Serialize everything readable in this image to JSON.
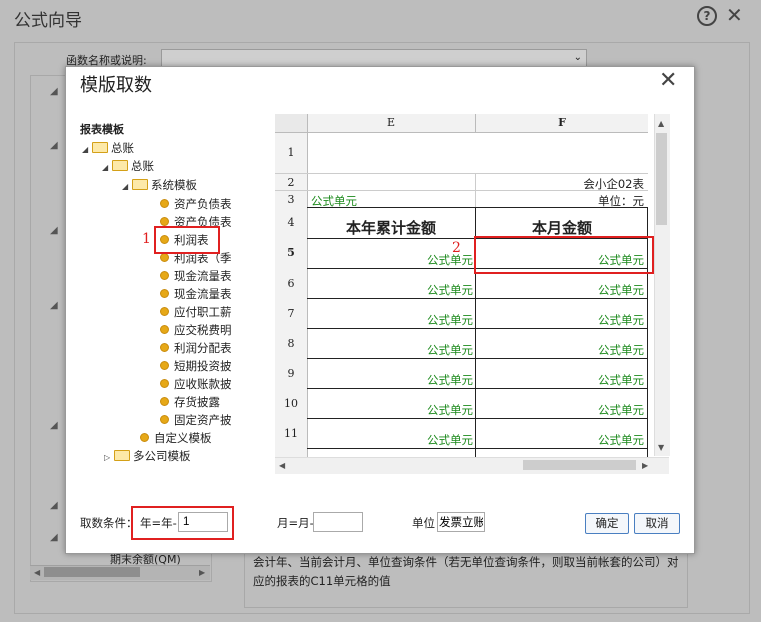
{
  "outer": {
    "title": "公式向导",
    "help_icon": "?",
    "close_icon": "✕",
    "function_label": "函数名称或说明:",
    "function_value": "",
    "bottom_item": "期末余额(QM)",
    "description": "会计年、当前会计月、单位查询条件（若无单位查询条件，则取当前帐套的公司）对应的报表的C11单元格的值"
  },
  "dialog": {
    "title": "模版取数",
    "close_icon": "✕",
    "tree_title": "报表模板",
    "tree": {
      "root": "总账",
      "level2": "总账",
      "level3": "系统模板",
      "items": [
        "资产负债表",
        "资产负债表",
        "利润表",
        "利润表（季",
        "现金流量表",
        "现金流量表",
        "应付职工薪",
        "应交税费明",
        "利润分配表",
        "短期投资披",
        "应收账款披",
        "存货披露",
        "固定资产披"
      ],
      "custom": "自定义模板",
      "multi": "多公司模板"
    },
    "sheet": {
      "col_e": "E",
      "col_f": "F",
      "row_numbers": [
        "1",
        "2",
        "3",
        "4",
        "5",
        "6",
        "7",
        "8",
        "9",
        "10",
        "11"
      ],
      "row2_f": "会小企02表",
      "row3_e": "公式单元",
      "row3_f": "单位：元",
      "header_e": "本年累计金额",
      "header_f": "本月金额",
      "formula_cell": "公式单元"
    },
    "annotations": {
      "marker1": "1",
      "marker2": "2"
    },
    "conditions": {
      "label": "取数条件：",
      "year_label": "年=年-",
      "year_value": "1",
      "month_label": "月=月-",
      "month_value": "",
      "unit_label": "单位",
      "unit_value": "发票立账"
    },
    "buttons": {
      "ok": "确定",
      "cancel": "取消"
    }
  }
}
